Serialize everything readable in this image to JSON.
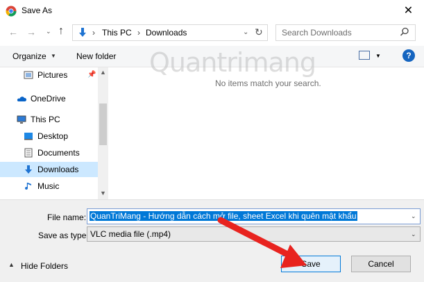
{
  "window": {
    "title": "Save As",
    "close_glyph": "✕"
  },
  "address": {
    "back_glyph": "←",
    "forward_glyph": "→",
    "recent_glyph": "⌄",
    "up_glyph": "↑",
    "crumbs": [
      "This PC",
      "Downloads"
    ],
    "sep": "›",
    "dropdown": "⌄",
    "refresh": "↻"
  },
  "search": {
    "placeholder": "Search Downloads"
  },
  "toolbar": {
    "organize": "Organize",
    "organize_caret": "▼",
    "new_folder": "New folder",
    "view_caret": "▼",
    "help": "?"
  },
  "sidebar": {
    "items": [
      {
        "label": "Pictures",
        "icon": "pictures-icon"
      },
      {
        "label": "OneDrive",
        "icon": "onedrive-icon"
      },
      {
        "label": "This PC",
        "icon": "this-pc-icon"
      },
      {
        "label": "Desktop",
        "icon": "desktop-icon"
      },
      {
        "label": "Documents",
        "icon": "documents-icon"
      },
      {
        "label": "Downloads",
        "icon": "downloads-icon",
        "selected": true
      },
      {
        "label": "Music",
        "icon": "music-icon"
      }
    ],
    "scroll_up": "▲",
    "scroll_down": "▼"
  },
  "content": {
    "empty_message": "No items match your search.",
    "watermark": "Quantrimang"
  },
  "form": {
    "filename_label": "File name:",
    "filename_value": "QuanTriMang - Hướng dẫn cách mở file, sheet Excel khi quên mật khẩu",
    "savetype_label": "Save as type:",
    "savetype_value": "VLC media file (.mp4)",
    "caret": "⌄"
  },
  "footer": {
    "hide_folders": "Hide Folders",
    "hide_caret": "▲",
    "save": "Save",
    "cancel": "Cancel"
  },
  "colors": {
    "accent": "#0078d7",
    "arrow": "#e8231f"
  }
}
